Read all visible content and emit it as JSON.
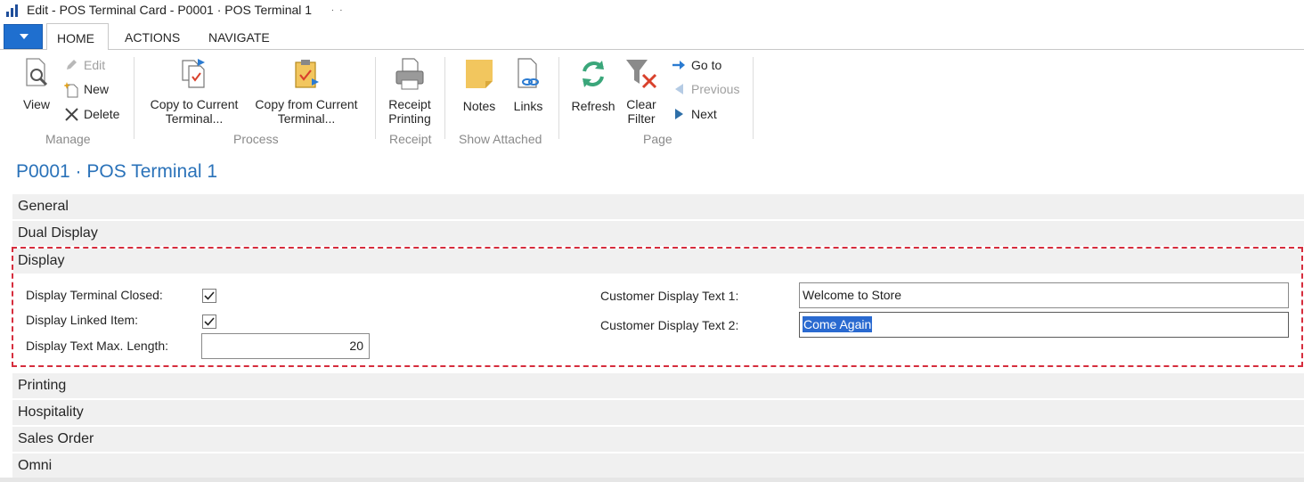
{
  "window": {
    "title": "Edit - POS Terminal Card - P0001 · POS Terminal 1",
    "title_dots": ". ."
  },
  "tabs": [
    {
      "label": "HOME",
      "active": true
    },
    {
      "label": "ACTIONS",
      "active": false
    },
    {
      "label": "NAVIGATE",
      "active": false
    }
  ],
  "ribbon": {
    "manage": {
      "label": "Manage",
      "view": "View",
      "edit": "Edit",
      "new": "New",
      "delete": "Delete"
    },
    "process": {
      "label": "Process",
      "copy_to_line1": "Copy to Current",
      "copy_to_line2": "Terminal...",
      "copy_from_line1": "Copy from Current",
      "copy_from_line2": "Terminal..."
    },
    "receipt": {
      "label": "Receipt",
      "printing_line1": "Receipt",
      "printing_line2": "Printing"
    },
    "show_attached": {
      "label": "Show Attached",
      "notes": "Notes",
      "links": "Links"
    },
    "page": {
      "label": "Page",
      "refresh": "Refresh",
      "clear_line1": "Clear",
      "clear_line2": "Filter",
      "goto": "Go to",
      "previous": "Previous",
      "next": "Next"
    }
  },
  "page_title": "P0001 · POS Terminal 1",
  "sections": {
    "general": "General",
    "dual_display": "Dual Display",
    "display": "Display",
    "printing": "Printing",
    "hospitality": "Hospitality",
    "sales_order": "Sales Order",
    "omni": "Omni"
  },
  "display_fields": {
    "terminal_closed_label": "Display Terminal Closed:",
    "terminal_closed_checked": true,
    "linked_item_label": "Display Linked Item:",
    "linked_item_checked": true,
    "max_length_label": "Display Text Max. Length:",
    "max_length_value": "20",
    "customer_text1_label": "Customer Display Text 1:",
    "customer_text1_value": "Welcome to Store",
    "customer_text2_label": "Customer Display Text 2:",
    "customer_text2_value": "Come Again"
  },
  "colors": {
    "accent": "#1f6fcf",
    "page_title": "#2a72b9",
    "focus_frame": "#d62d3d",
    "selection": "#2a6ad0"
  }
}
